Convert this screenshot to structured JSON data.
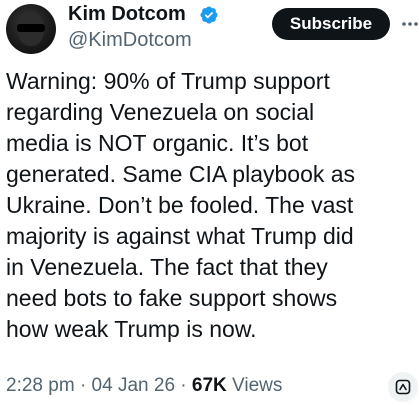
{
  "author": {
    "name": "Kim Dotcom",
    "handle": "@KimDotcom",
    "verified": true
  },
  "actions": {
    "subscribe_label": "Subscribe"
  },
  "tweet": {
    "lines": [
      "Warning: 90% of Trump support",
      "regarding Venezuela on social",
      "media is NOT organic. It’s bot",
      "generated. Same CIA playbook as",
      "Ukraine. Don’t be fooled. The vast",
      "majority is against what Trump did",
      "in Venezuela. The fact that they",
      "need bots to fake support shows",
      "how weak Trump is now."
    ]
  },
  "meta": {
    "time": "2:28 pm",
    "separator": "·",
    "date": "04 Jan 26",
    "views_count": "67K",
    "views_label": "Views"
  },
  "icons": {
    "verified": "verified-badge-icon",
    "more": "more-options-icon",
    "grok": "grok-explain-icon"
  },
  "colors": {
    "verified": "#1d9bf0",
    "subscribe_bg": "#0f1419",
    "secondary_text": "#536471"
  }
}
